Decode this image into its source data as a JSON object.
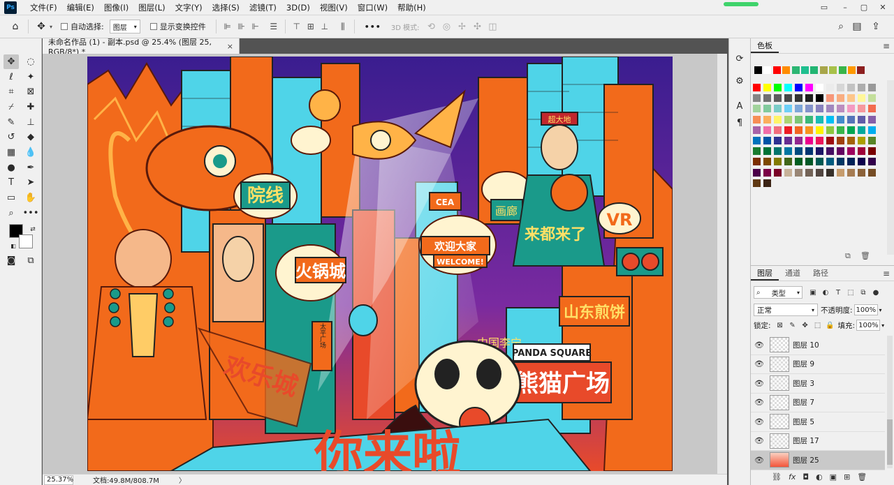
{
  "app": {
    "logo": "Ps",
    "menu": [
      "文件(F)",
      "编辑(E)",
      "图像(I)",
      "图层(L)",
      "文字(Y)",
      "选择(S)",
      "滤镜(T)",
      "3D(D)",
      "视图(V)",
      "窗口(W)",
      "帮助(H)"
    ],
    "window_controls": [
      "▭",
      "–",
      "▢",
      "✕"
    ]
  },
  "options_bar": {
    "auto_select_label": "自动选择:",
    "auto_select_value": "图层",
    "show_transform_label": "显示变换控件",
    "more": "•••",
    "mode3d_label": "3D 模式:"
  },
  "document": {
    "tab_title": "未命名作品 (1) - 副本.psd @ 25.4% (图层 25, RGB/8*) *",
    "close": "×",
    "zoom": "25.37%",
    "doc_size": "文档:49.8M/808.7M",
    "status_arrow": "〉"
  },
  "artwork": {
    "sign_cinema": "院线",
    "sign_hotpot": "火锅城",
    "sign_welcome_cn": "欢迎大家",
    "sign_welcome_en": "WELCOME!",
    "sign_gallery": "画廊",
    "sign_vr": "VR",
    "sign_shandong": "山东煎饼",
    "sign_lining": "中国李宁",
    "sign_panda_square_en": "PANDA SQUARE",
    "sign_panda_square_cn": "熊猫广场",
    "sign_happy_city": "欢乐城",
    "sign_tianfu": "太平广场",
    "sign_billboard": "CEA",
    "sign_you_came": "你来啦",
    "sign_slogan": "来都来了",
    "sign_hat": "超大地"
  },
  "swatches_panel": {
    "tab": "色板",
    "menu": "≡",
    "recent": [
      "#000000",
      "#ffffff",
      "#ff0000",
      "#ff8c00",
      "#2bb673",
      "#1fbf8f",
      "#22b573",
      "#a8a64a",
      "#a8c14a",
      "#39b54a",
      "#ff9900",
      "#8c1f1f"
    ],
    "grid": [
      "#ff0000",
      "#ffff00",
      "#00ff00",
      "#00ffff",
      "#0000ff",
      "#ff00ff",
      "#ffffff",
      "#ebebeb",
      "#d6d6d6",
      "#c2c2c2",
      "#adadad",
      "#999999",
      "#858585",
      "#707070",
      "#5c5c5c",
      "#474747",
      "#333333",
      "#1f1f1f",
      "#000000",
      "#f7977a",
      "#f9ad81",
      "#fdc68a",
      "#fff79a",
      "#c4df9b",
      "#a2d39c",
      "#82ca9d",
      "#7bcdc8",
      "#6ecff6",
      "#7ea7d8",
      "#8493ca",
      "#8882be",
      "#a187be",
      "#bc8dbf",
      "#f49ac2",
      "#f6989d",
      "#f26c4f",
      "#f68e55",
      "#fbaf5c",
      "#fff467",
      "#acd372",
      "#7cc576",
      "#3bb878",
      "#1abbb4",
      "#00bff3",
      "#438ccb",
      "#5574b9",
      "#605ca8",
      "#855fa8",
      "#a763a8",
      "#f06ea9",
      "#f26d7d",
      "#ed1c24",
      "#f26522",
      "#f7941d",
      "#fff200",
      "#8dc73f",
      "#39b54a",
      "#00a651",
      "#00a99d",
      "#00aeef",
      "#0072bc",
      "#0054a6",
      "#2e3192",
      "#662d91",
      "#92278f",
      "#ec008c",
      "#ed145b",
      "#9e0b0f",
      "#a0410d",
      "#a36209",
      "#aba000",
      "#598527",
      "#197b30",
      "#007236",
      "#00746b",
      "#0076a3",
      "#004b80",
      "#003471",
      "#1b1464",
      "#440e62",
      "#630460",
      "#9e005d",
      "#9e0039",
      "#790000",
      "#7b2e00",
      "#7d4900",
      "#827b00",
      "#406618",
      "#005e20",
      "#005826",
      "#005952",
      "#005b7f",
      "#003663",
      "#002157",
      "#0d004c",
      "#32004b",
      "#4b0049",
      "#7b0046",
      "#7a0026",
      "#c7b299",
      "#998675",
      "#736357",
      "#534741",
      "#37302a",
      "#c69c6d",
      "#a67c52",
      "#8c6239",
      "#754c24",
      "#603913",
      "#3c2415"
    ],
    "footer": [
      "⧉",
      "🗑"
    ]
  },
  "layers_panel": {
    "tabs": [
      "图层",
      "通道",
      "路径"
    ],
    "menu": "≡",
    "kind_label": "类型",
    "blend_mode": "正常",
    "opacity_label": "不透明度:",
    "opacity_value": "100%",
    "lock_label": "锁定:",
    "fill_label": "填充:",
    "fill_value": "100%",
    "layers": [
      {
        "name": "图层 10",
        "selected": false
      },
      {
        "name": "图层 9",
        "selected": false
      },
      {
        "name": "图层 3",
        "selected": false
      },
      {
        "name": "图层 7",
        "selected": false
      },
      {
        "name": "图层 5",
        "selected": false
      },
      {
        "name": "图层 17",
        "selected": false
      },
      {
        "name": "图层 25",
        "selected": true
      }
    ],
    "footer": [
      "⛓",
      "fx",
      "◘",
      "◐",
      "▣",
      "⊞",
      "🗑"
    ]
  },
  "colors": {
    "ui_bg": "#f0f0f0",
    "canvas_bg": "#c8c8c8",
    "accent_green": "#3fd36b",
    "art_sky": "#3a1d8f",
    "art_orange": "#f26a1b",
    "art_cyan": "#4fd4e8"
  }
}
